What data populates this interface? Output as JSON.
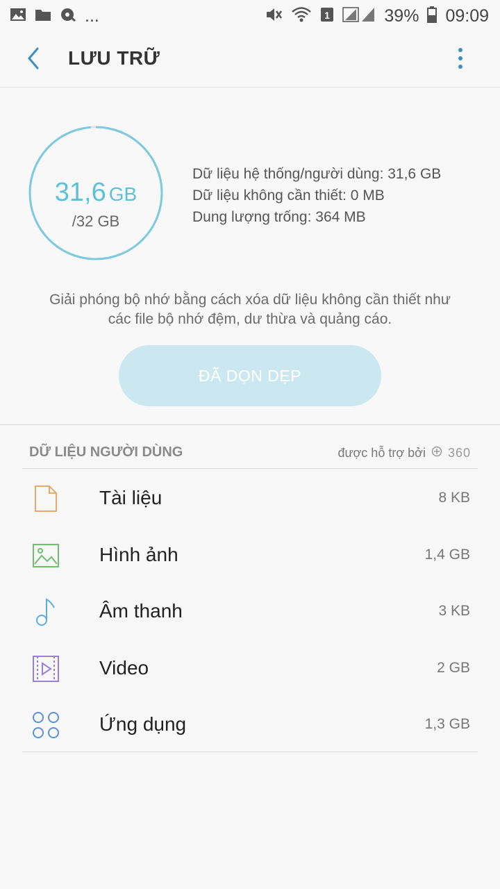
{
  "status_bar": {
    "battery": "39%",
    "time": "09:09",
    "dots": "...",
    "sim_badge": "1"
  },
  "header": {
    "title": "LƯU TRỮ"
  },
  "summary": {
    "used_value": "31,6",
    "used_unit": "GB",
    "total": "/32 GB",
    "used_fraction": 0.9875,
    "ring_color": "#7dcae0",
    "lines": [
      "Dữ liệu hệ thống/người dùng: 31,6 GB",
      "Dữ liệu không cần thiết: 0 MB",
      "Dung lượng trống: 364 MB"
    ]
  },
  "hint": {
    "line1": "Giải phóng bộ nhớ bằng cách xóa dữ liệu không cần thiết như",
    "line2": "các file bộ nhớ đệm, dư thừa và quảng cáo."
  },
  "clean_button": {
    "label": "ĐÃ DỌN DẸP"
  },
  "user_data": {
    "heading": "DỮ LIỆU NGƯỜI DÙNG",
    "powered_by": "được hỗ trợ bởi",
    "powered_brand": "360",
    "items": [
      {
        "label": "Tài liệu",
        "size": "8 KB",
        "icon": "document-icon",
        "color": "#e8a86a"
      },
      {
        "label": "Hình ảnh",
        "size": "1,4 GB",
        "icon": "image-icon",
        "color": "#6cc070"
      },
      {
        "label": "Âm thanh",
        "size": "3 KB",
        "icon": "music-note-icon",
        "color": "#5aaede"
      },
      {
        "label": "Video",
        "size": "2 GB",
        "icon": "video-icon",
        "color": "#9a7fd6"
      },
      {
        "label": "Ứng dụng",
        "size": "1,3 GB",
        "icon": "apps-icon",
        "color": "#5a8fde"
      }
    ]
  }
}
